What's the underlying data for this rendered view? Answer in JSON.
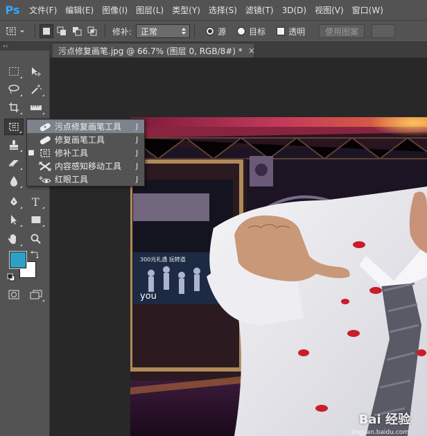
{
  "app": {
    "logo": "Ps"
  },
  "menu": [
    "文件(F)",
    "编辑(E)",
    "图像(I)",
    "图层(L)",
    "类型(Y)",
    "选择(S)",
    "滤镜(T)",
    "3D(D)",
    "视图(V)",
    "窗口(W)"
  ],
  "options": {
    "tool_icon": "patch-icon",
    "patch_label": "修补:",
    "patch_mode": "正常",
    "source_label": "源",
    "target_label": "目标",
    "transparent_label": "透明",
    "use_pattern_label": "使用图案"
  },
  "toolbox": {
    "collapse_glyph": "‹‹",
    "foreground_color": "#2ea0c6",
    "background_color": "#ffffff"
  },
  "document": {
    "tab_title": "污点修复画笔.jpg @ 66.7% (图层 0, RGB/8#) *",
    "close_glyph": "×"
  },
  "flyout": {
    "items": [
      {
        "label": "污点修复画笔工具",
        "shortcut": "J",
        "icon": "spot-healing-brush-icon",
        "highlighted": true,
        "current": false
      },
      {
        "label": "修复画笔工具",
        "shortcut": "J",
        "icon": "healing-brush-icon",
        "highlighted": false,
        "current": false
      },
      {
        "label": "修补工具",
        "shortcut": "J",
        "icon": "patch-icon",
        "highlighted": false,
        "current": true
      },
      {
        "label": "内容感知移动工具",
        "shortcut": "J",
        "icon": "content-aware-move-icon",
        "highlighted": false,
        "current": false
      },
      {
        "label": "红眼工具",
        "shortcut": "J",
        "icon": "red-eye-icon",
        "highlighted": false,
        "current": false
      }
    ]
  },
  "photo": {
    "screen_text_1": "300元礼遇 玩转道",
    "screen_text_2": "you"
  },
  "watermark": {
    "brand": "Bai 经验",
    "url": "jingyan.baidu.com"
  }
}
